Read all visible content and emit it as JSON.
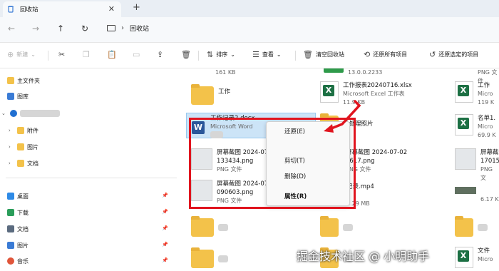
{
  "window": {
    "tab_title": "回收站",
    "close_glyph": "✕",
    "newtab_glyph": "+"
  },
  "address": {
    "back_glyph": "←",
    "forward_glyph": "→",
    "up_glyph": "↑",
    "refresh_glyph": "↻",
    "chevron_glyph": "›",
    "path": "回收站"
  },
  "toolbar": {
    "new_label": "新建",
    "new_icon_glyph": "⊕",
    "cut_glyph": "✂",
    "copy_glyph": "❐",
    "paste_glyph": "📋",
    "rename_glyph": "▭",
    "share_glyph": "⇪",
    "delete_glyph": "🗑",
    "sort_label": "排序",
    "sort_glyph": "⇅",
    "view_label": "查看",
    "view_glyph": "☰",
    "empty_label": "清空回收站",
    "empty_glyph": "🗑",
    "restore_all_label": "还原所有项目",
    "restore_all_glyph": "⟲",
    "restore_sel_label": "还原选定的项目",
    "restore_sel_glyph": "↺",
    "caret": "⌄"
  },
  "sidebar": {
    "home": "主文件夹",
    "gallery": "图库",
    "cloud_items": [
      "附件",
      "图片",
      "文档"
    ],
    "quick": [
      "桌面",
      "下载",
      "文档",
      "图片",
      "音乐"
    ],
    "pin_glyph": "📌",
    "arrow_right": "›",
    "arrow_down": "⌄"
  },
  "files": {
    "top_row": [
      {
        "size": "161 KB"
      },
      {
        "size": "13.0.0.2233"
      },
      {
        "size": "PNG 文件"
      }
    ],
    "row1": {
      "folder_name": "工作",
      "xlsx_name": "工作报表20240716.xlsx",
      "xlsx_type": "Microsoft Excel 工作表",
      "xlsx_size": "11.9 KB",
      "right_name": "工作",
      "right_type": "Micro",
      "right_size": "119 K"
    },
    "row2": {
      "doc_name": "工作记录2.docx",
      "doc_type": "Microsoft Word",
      "batch_name": "批处理照片",
      "right_name": "名单1.",
      "right_type": "Micro",
      "right_size": "69.9 K"
    },
    "row3": {
      "s1_name": "屏幕截图 2024-07",
      "s1_time": "133434.png",
      "s1_type": "PNG 文件",
      "s2_name": "屏幕截图 2024-07-02",
      "s2_time": "3617.png",
      "s2_type": "PNG 文件",
      "s3_name": "屏幕截",
      "s3_time": "17015",
      "s3_type": "PNG 文"
    },
    "row4": {
      "s1_name": "屏幕截图 2024-07",
      "s1_time": "090603.png",
      "s1_type": "PNG 文件",
      "mp4_name": "记录.mp4",
      "mp4_size": "1.29 MB",
      "right_size": "6.17 K"
    },
    "row6": {
      "right_name": "文件",
      "right_type": "Micro"
    }
  },
  "context_menu": {
    "restore": "还原(E)",
    "cut": "剪切(T)",
    "delete": "删除(D)",
    "properties": "属性(R)"
  },
  "watermark": "掘金技术社区 @ 小明助手",
  "colors": {
    "highlight": "#e0141e",
    "folder": "#f3c24a",
    "excel": "#1d7044",
    "word": "#2b579a",
    "selection": "#cce4f7"
  }
}
